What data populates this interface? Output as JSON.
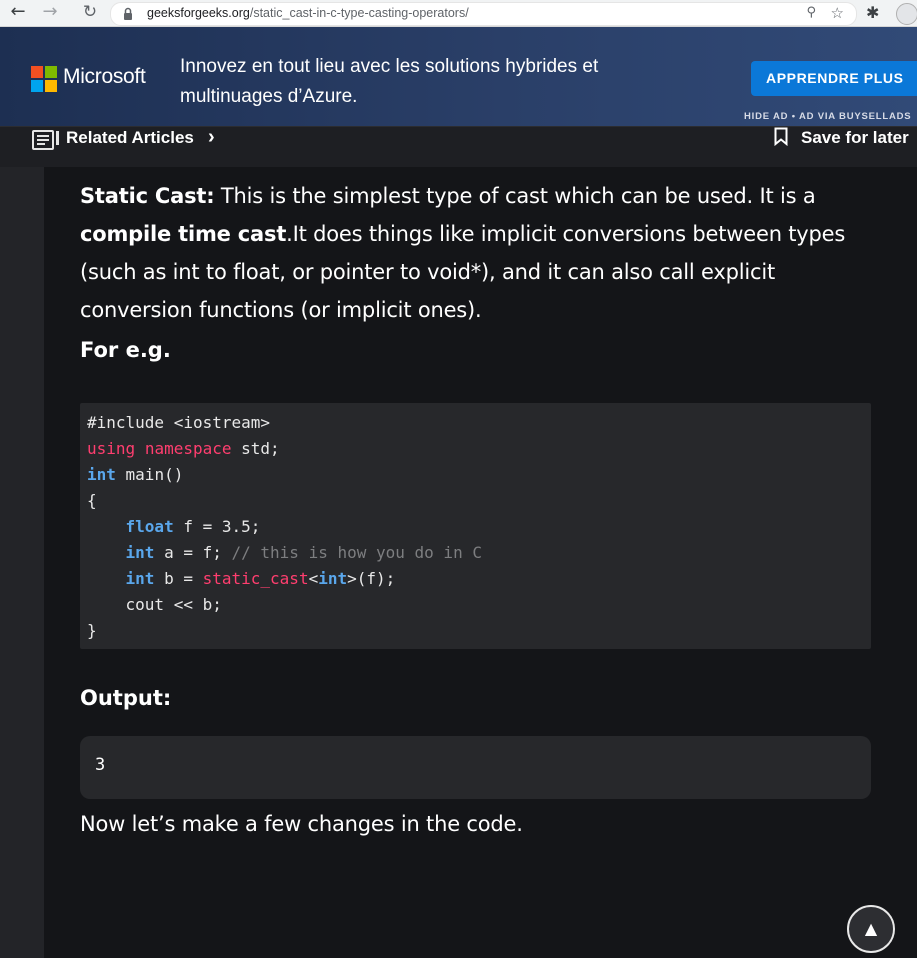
{
  "browser": {
    "url_host": "geeksforgeeks.org",
    "url_path": "/static_cast-in-c-type-casting-operators/",
    "back_icon": "back-arrow-icon",
    "forward_icon": "forward-arrow-icon",
    "reload_icon": "reload-icon"
  },
  "ad": {
    "brand": "Microsoft",
    "text_line1": "Innovez en tout lieu avec les solutions hybrides et",
    "text_line2": "multinuages d’Azure.",
    "cta": "APPRENDRE PLUS",
    "hide_ad": "HIDE AD • AD VIA BUYSELLADS",
    "cta_color": "#0b78d8"
  },
  "related": {
    "label": "Related Articles",
    "save_label": "Save for later"
  },
  "article": {
    "p1_bold": "Static Cast:",
    "p1_rest": " This is the simplest type of cast which can be used. It is a",
    "p2_bold": "compile time cast",
    "p2_rest": ".It does things like implicit conversions between types (such as int to float, or pointer to void*), and it can also call explicit conversion functions (or implicit ones).",
    "for_eg": "For e.g.",
    "output_label": "Output:",
    "output_value": "3",
    "next_text": "Now let’s make a few changes in the code."
  },
  "code": {
    "include": "#include <iostream>",
    "using": "using",
    "namespace": "namespace",
    "std": " std;",
    "int": "int",
    "main": " main()",
    "open_brace": "{",
    "float": "float",
    "float_rest": " f = 3.5;",
    "int_a_rest": " a = f;",
    "comment": " // this is how you do in C",
    "int_b_rest": " b = ",
    "static_cast": "static_cast",
    "lt": "<",
    "gt_rest": ">(f);",
    "cout": "cout << b;",
    "close_brace": "}"
  },
  "colors": {
    "keyword": "#5aa7ec",
    "keyword_pink": "#ff3e6f",
    "comment": "#7d7e80",
    "code_bg": "#27282b"
  }
}
